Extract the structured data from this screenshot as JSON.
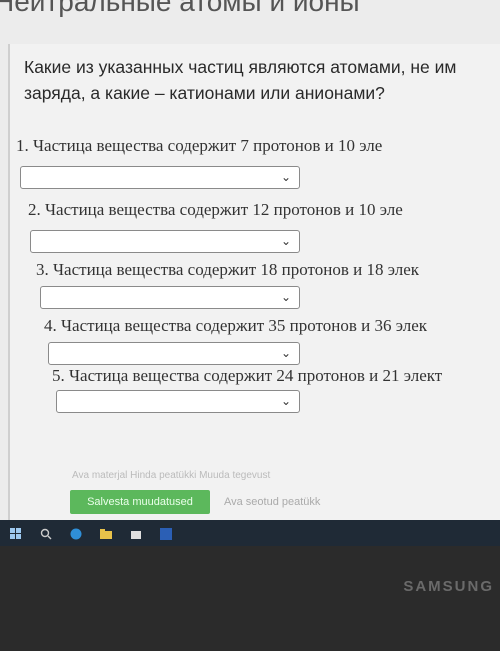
{
  "heading": "Нейтральные атомы и ионы",
  "question": "Какие из указанных частиц являются атомами, не им\nзаряда, а какие – катионами или анионами?",
  "items": [
    {
      "label": "1. Частица вещества содержит 7 протонов и 10 эле"
    },
    {
      "label": "2. Частица вещества содержит 12 протонов и 10 эле"
    },
    {
      "label": "3. Частица вещества содержит 18 протонов и 18 элек"
    },
    {
      "label": "4. Частица вещества содержит 35 протонов и 36 элек"
    },
    {
      "label": "5. Частица вещества содержит 24 протонов и 21 элект"
    }
  ],
  "footer": {
    "links": "Ava materjal   Hinda peatükki   Muuda tegevust",
    "save_label": "Salvesta muudatused",
    "related_label": "Ava seotud peatükk"
  },
  "taskbar_icons": [
    "windows-icon",
    "search-icon",
    "edge-icon",
    "folder-icon",
    "store-icon",
    "word-icon"
  ],
  "brand": "SAMSUNG"
}
